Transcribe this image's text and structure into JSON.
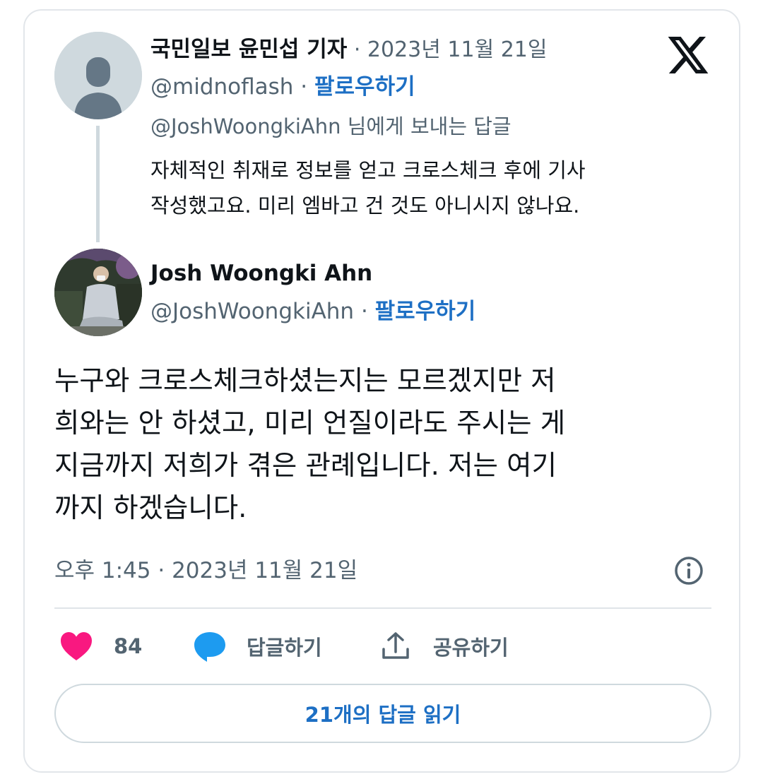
{
  "reply_tweet": {
    "author_name": "국민일보 윤민섭 기자",
    "date": "2023년 11월 21일",
    "handle": "@midnoflash",
    "follow_label": "팔로우하기",
    "reply_to": "@JoshWoongkiAhn 님에게 보내는 답글",
    "body_line1": "자체적인 취재로 정보를 얻고 크로스체크 후에 기사",
    "body_line2": "작성했고요. 미리 엠바고 건 것도 아니시지 않나요."
  },
  "main_tweet": {
    "author_name": "Josh Woongki Ahn",
    "handle": "@JoshWoongkiAhn",
    "follow_label": "팔로우하기",
    "text_line1": "누구와 크로스체크하셨는지는 모르겠지만 저",
    "text_line2": "희와는 안 하셨고, 미리 언질이라도 주시는 게",
    "text_line3": "지금까지 저희가 겪은 관례입니다. 저는 여기",
    "text_line4": "까지 하겠습니다.",
    "timestamp": "오후 1:45 · 2023년 11월 21일"
  },
  "actions": {
    "like_count": "84",
    "reply_label": "답글하기",
    "share_label": "공유하기"
  },
  "read_replies_label": "21개의 답글 읽기",
  "separator": "·",
  "icons": {
    "logo": "x-logo-icon",
    "info": "info-icon",
    "like": "heart-icon",
    "reply": "speech-bubble-icon",
    "share": "share-upload-icon"
  },
  "colors": {
    "link": "#1d6fc4",
    "muted": "#536471",
    "heart": "#f91880",
    "bubble": "#1d9bf0",
    "text": "#0f1419"
  }
}
